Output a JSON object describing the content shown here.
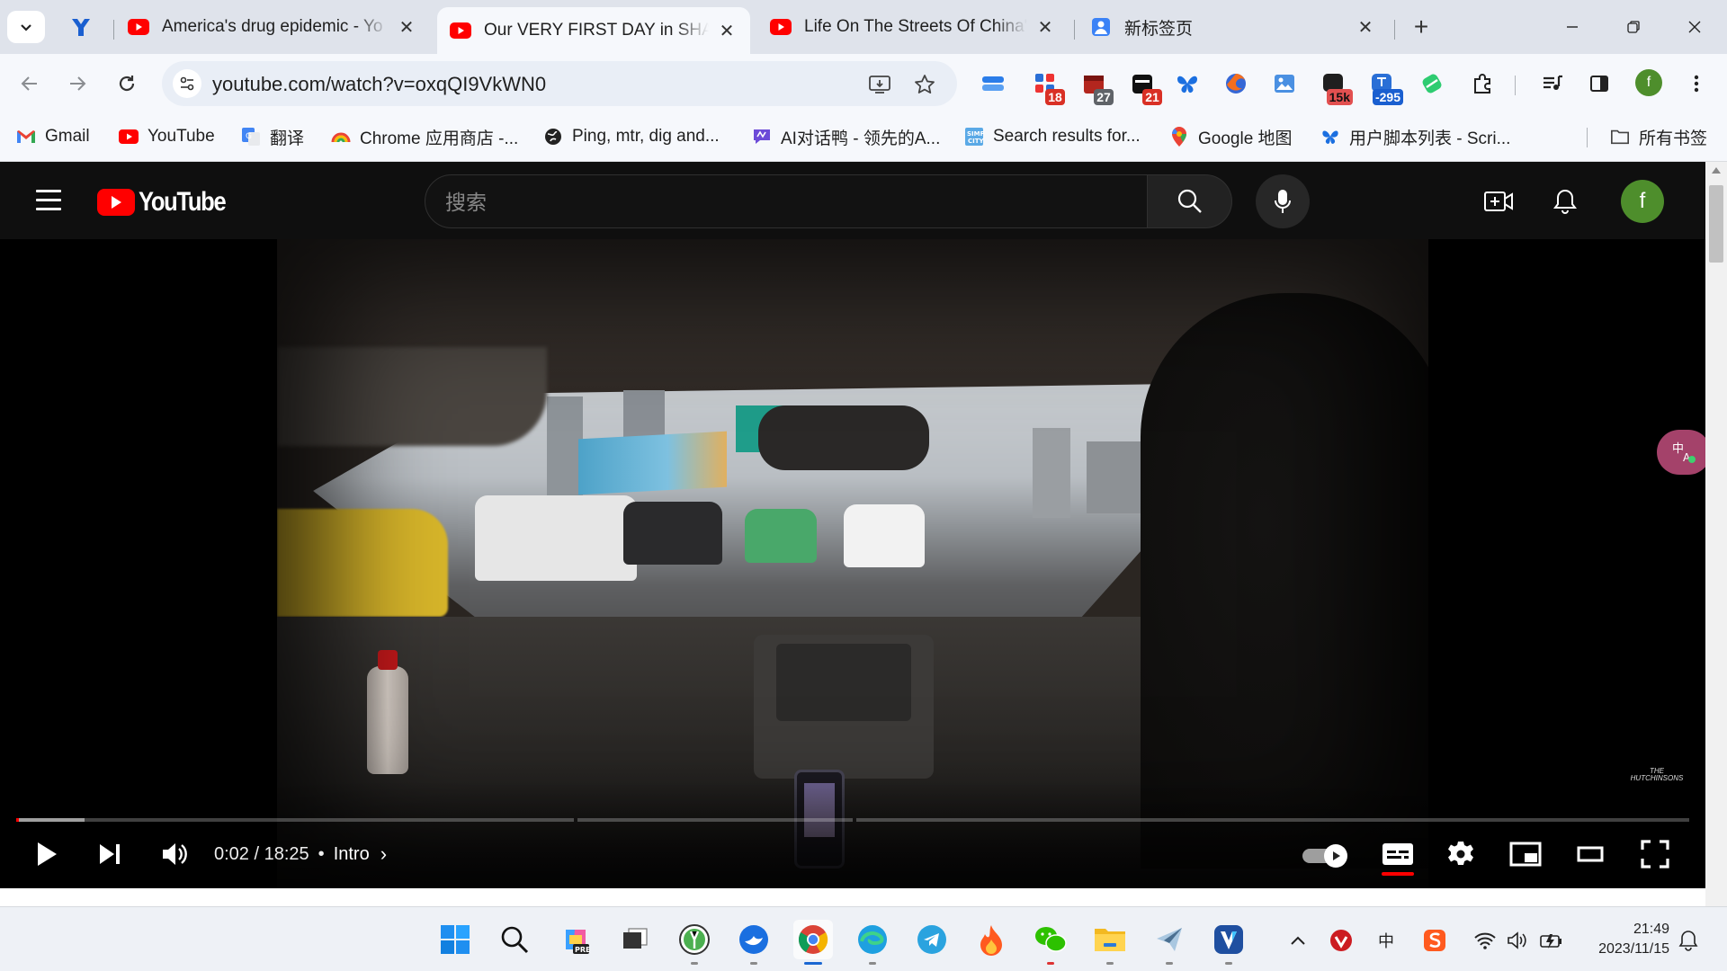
{
  "browser": {
    "tabs": [
      {
        "title": "America's drug epidemic - Yo",
        "active": false
      },
      {
        "title": "Our VERY FIRST DAY in SHAN",
        "active": true
      },
      {
        "title": "Life On The Streets Of China'",
        "active": false
      },
      {
        "title": "新标签页",
        "active": false
      }
    ],
    "url": "youtube.com/watch?v=oxqQI9VkWN0",
    "extension_badges": {
      "ext_calendar_red": "18",
      "ext_calendar_grey": "27",
      "ext_calendar_black": "21",
      "ext_counter_15k": "15k",
      "ext_counter_295": "-295"
    },
    "profile_initial": "f",
    "bookmarks": [
      {
        "label": "Gmail"
      },
      {
        "label": "YouTube"
      },
      {
        "label": "翻译"
      },
      {
        "label": "Chrome 应用商店 -..."
      },
      {
        "label": "Ping, mtr, dig and..."
      },
      {
        "label": "AI对话鸭 - 领先的A..."
      },
      {
        "label": "Search results for..."
      },
      {
        "label": "Google 地图"
      },
      {
        "label": "用户脚本列表 - Scri..."
      }
    ],
    "all_bookmarks_label": "所有书签"
  },
  "youtube": {
    "logo_text": "YouTube",
    "search_placeholder": "搜索",
    "avatar_initial": "f",
    "watermark": "THE HUTCHINSONS",
    "player": {
      "time_current": "0:02",
      "time_separator": " / ",
      "time_total": "18:25",
      "chapter_dot": "•",
      "chapter": "Intro",
      "progress_fraction": 0.0018,
      "buffered_fraction": 0.041,
      "autoplay_on": true,
      "captions_on": true
    }
  },
  "taskbar": {
    "clock_time": "21:49",
    "clock_date": "2023/11/15",
    "ime_label": "中"
  },
  "colors": {
    "youtube_red": "#ff0000",
    "profile_green": "#4e8e2c",
    "chrome_blue": "#1a67d2"
  }
}
